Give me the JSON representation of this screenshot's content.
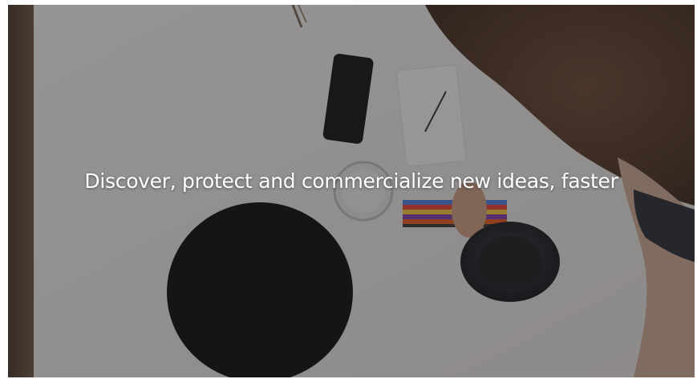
{
  "hero": {
    "headline": "Discover, protect and commercialize new ideas, faster"
  },
  "colors": {
    "overlay": "#1e1c1e",
    "headline_text": "#ffffff",
    "table_surface": "#e9e7e5",
    "wood_edge": "#5b4638"
  }
}
